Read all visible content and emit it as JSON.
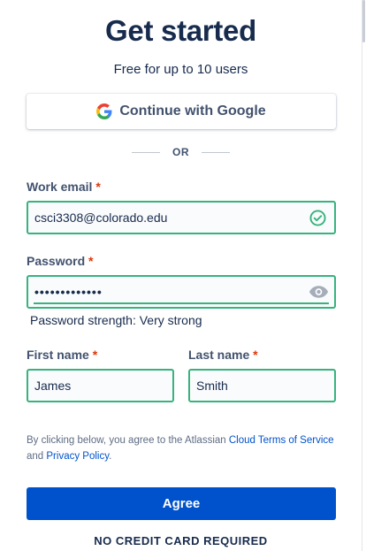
{
  "header": {
    "title": "Get started",
    "subtitle": "Free for up to 10 users"
  },
  "google": {
    "label": "Continue with Google",
    "icon": "google-g-icon"
  },
  "divider": {
    "text": "OR"
  },
  "email": {
    "label": "Work email",
    "required_mark": "*",
    "value": "csci3308@colorado.edu",
    "status_icon": "check-circle-icon"
  },
  "password": {
    "label": "Password",
    "required_mark": "*",
    "value": "•••••••••••••",
    "toggle_icon": "eye-icon",
    "strength": "Password strength: Very strong"
  },
  "first_name": {
    "label": "First name",
    "required_mark": "*",
    "value": "James"
  },
  "last_name": {
    "label": "Last name",
    "required_mark": "*",
    "value": "Smith"
  },
  "terms": {
    "prefix": "By clicking below, you agree to the Atlassian ",
    "cloud_terms_link": "Cloud Terms of Service",
    "and": " and ",
    "privacy_link": "Privacy Policy",
    "suffix": "."
  },
  "agree_button": {
    "label": "Agree"
  },
  "footer": {
    "note": "NO CREDIT CARD REQUIRED"
  },
  "colors": {
    "valid_green": "#36b37e",
    "primary_blue": "#0052cc",
    "required_red": "#de350b",
    "text_dark": "#172b4d"
  }
}
